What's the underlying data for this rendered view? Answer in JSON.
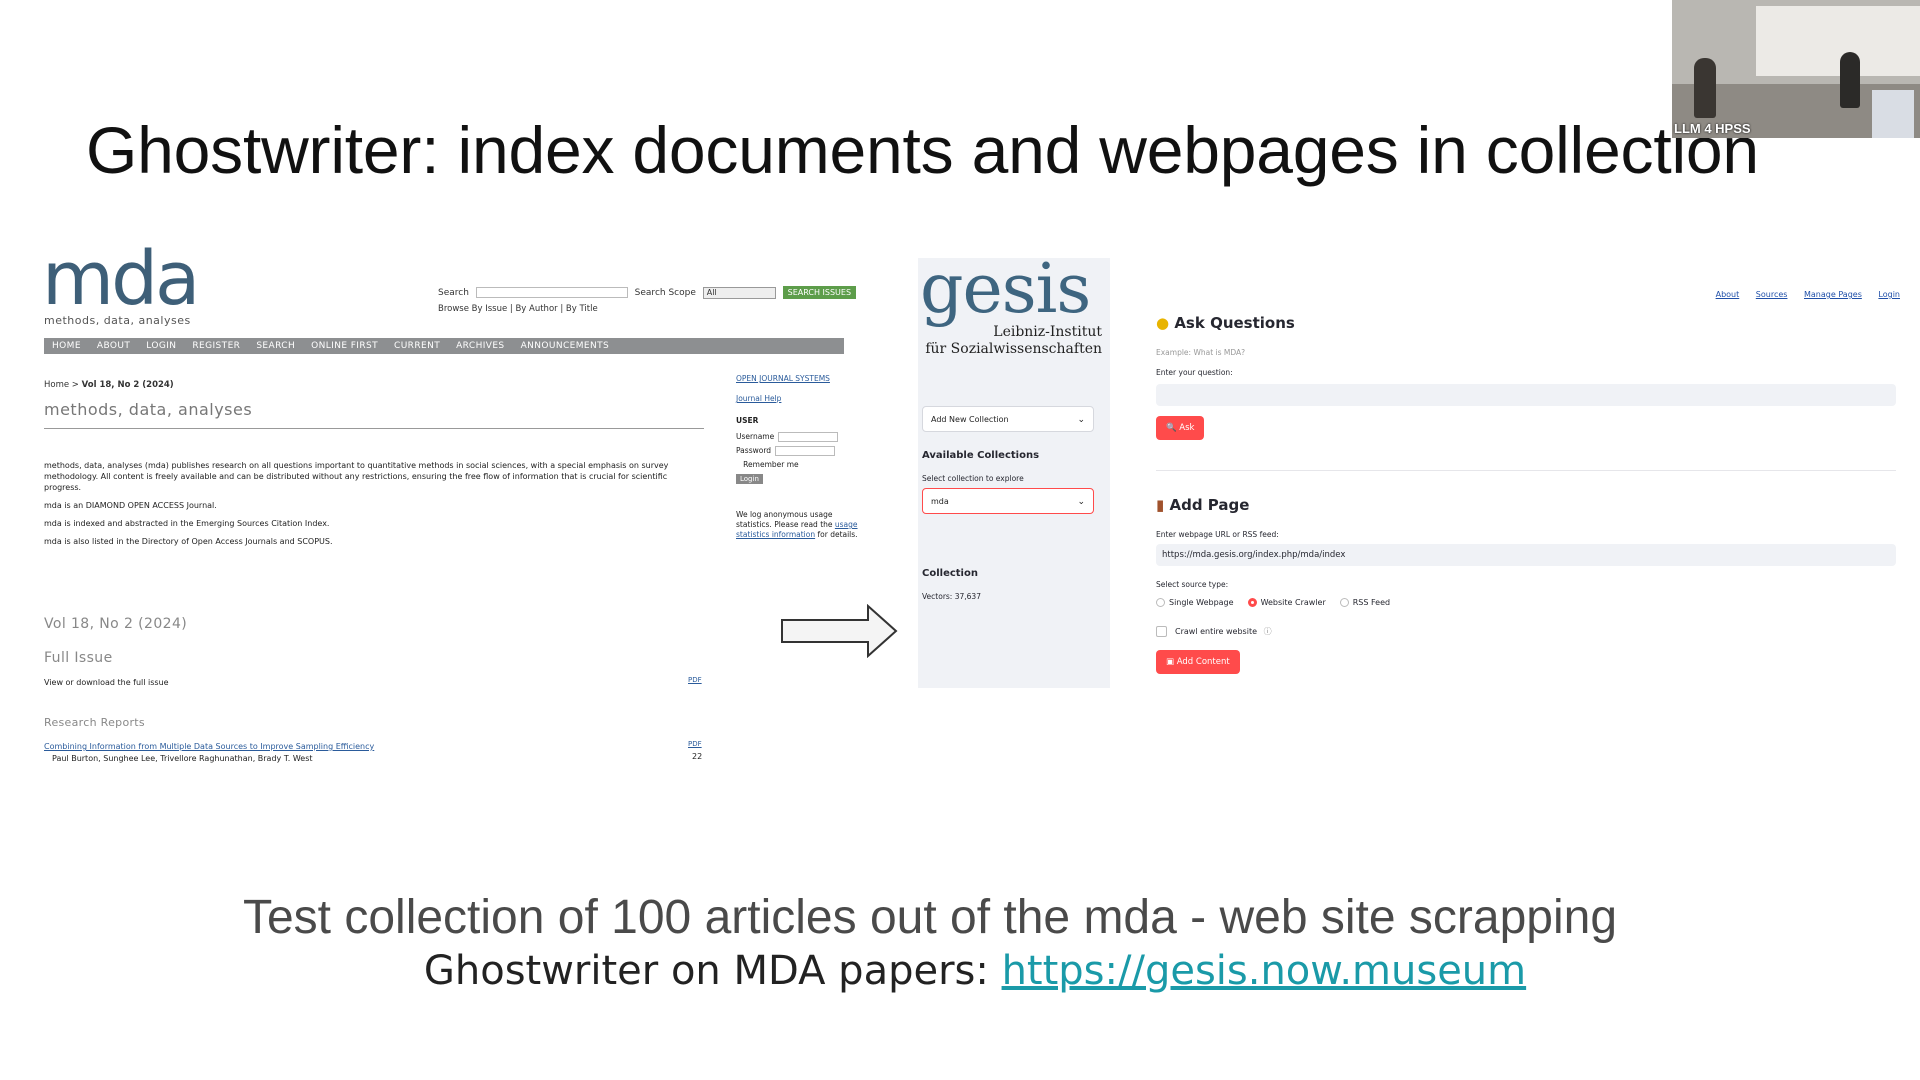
{
  "slide": {
    "title": "Ghostwriter: index documents and webpages in collection",
    "subtitle": "Test collection of 100 articles out of the mda - web site scrapping",
    "link_prefix": "Ghostwriter on MDA papers: ",
    "link_text": "https://gesis.now.museum"
  },
  "video": {
    "caption": "LLM 4 HPSS"
  },
  "mda": {
    "logo": "mda",
    "logo_sub": "methods, data, analyses",
    "search_label": "Search",
    "scope_label": "Search Scope",
    "scope_value": "All",
    "search_button": "SEARCH ISSUES",
    "browse": "Browse By Issue | By Author | By Title",
    "nav": [
      "HOME",
      "ABOUT",
      "LOGIN",
      "REGISTER",
      "SEARCH",
      "ONLINE FIRST",
      "CURRENT",
      "ARCHIVES",
      "ANNOUNCEMENTS"
    ],
    "crumb_home": "Home",
    "crumb_current": "Vol 18, No 2 (2024)",
    "heading": "methods, data, analyses",
    "para1": "methods, data, analyses (mda) publishes research on all questions important to quantitative methods in social sciences, with a special emphasis on survey methodology. All content is freely available and can be distributed  without any restrictions, ensuring the free flow of information that is crucial for scientific progress.",
    "para2": "mda is an DIAMOND OPEN ACCESS Journal.",
    "para3": "mda is indexed and abstracted in the Emerging Sources Citation Index.",
    "para4": "mda is also listed in the Directory of Open Access Journals and SCOPUS.",
    "side_ojs": "OPEN JOURNAL SYSTEMS",
    "side_help": "Journal Help",
    "side_user": "USER",
    "side_username": "Username",
    "side_password": "Password",
    "side_remember": "Remember me",
    "side_login": "Login",
    "side_note_pre": "We log anonymous usage statistics. Please read the ",
    "side_note_link": "usage statistics information",
    "side_note_post": " for details.",
    "issue": "Vol 18, No 2 (2024)",
    "full_issue": "Full Issue",
    "full_issue_text": "View or download the full issue",
    "pdf": "PDF",
    "research_reports": "Research Reports",
    "article_title": "Combining Information from Multiple Data Sources to Improve Sampling Efficiency",
    "article_authors": "Paul Burton, Sunghee Lee, Trivellore Raghunathan, Brady T. West",
    "article_page": "22"
  },
  "gesis": {
    "logo": "gesis",
    "logo_sub1": "Leibniz-Institut",
    "logo_sub2": "für Sozialwissenschaften",
    "add_collection": "Add New Collection",
    "available": "Available Collections",
    "select_label": "Select collection to explore",
    "selected": "mda",
    "collection_label": "Collection",
    "vectors": "Vectors: 37,637",
    "nav": [
      "About",
      "Sources",
      "Manage Pages",
      "Login"
    ],
    "ask_heading": "Ask Questions",
    "ask_example": "Example: What is MDA?",
    "ask_prompt": "Enter your question:",
    "ask_button": "Ask",
    "add_heading": "Add Page",
    "url_label": "Enter webpage URL or RSS feed:",
    "url_value": "https://mda.gesis.org/index.php/mda/index",
    "source_label": "Select source type:",
    "radios": [
      "Single Webpage",
      "Website Crawler",
      "RSS Feed"
    ],
    "crawl": "Crawl entire website",
    "add_button": "Add Content",
    "accent": "#ff4b4b"
  }
}
